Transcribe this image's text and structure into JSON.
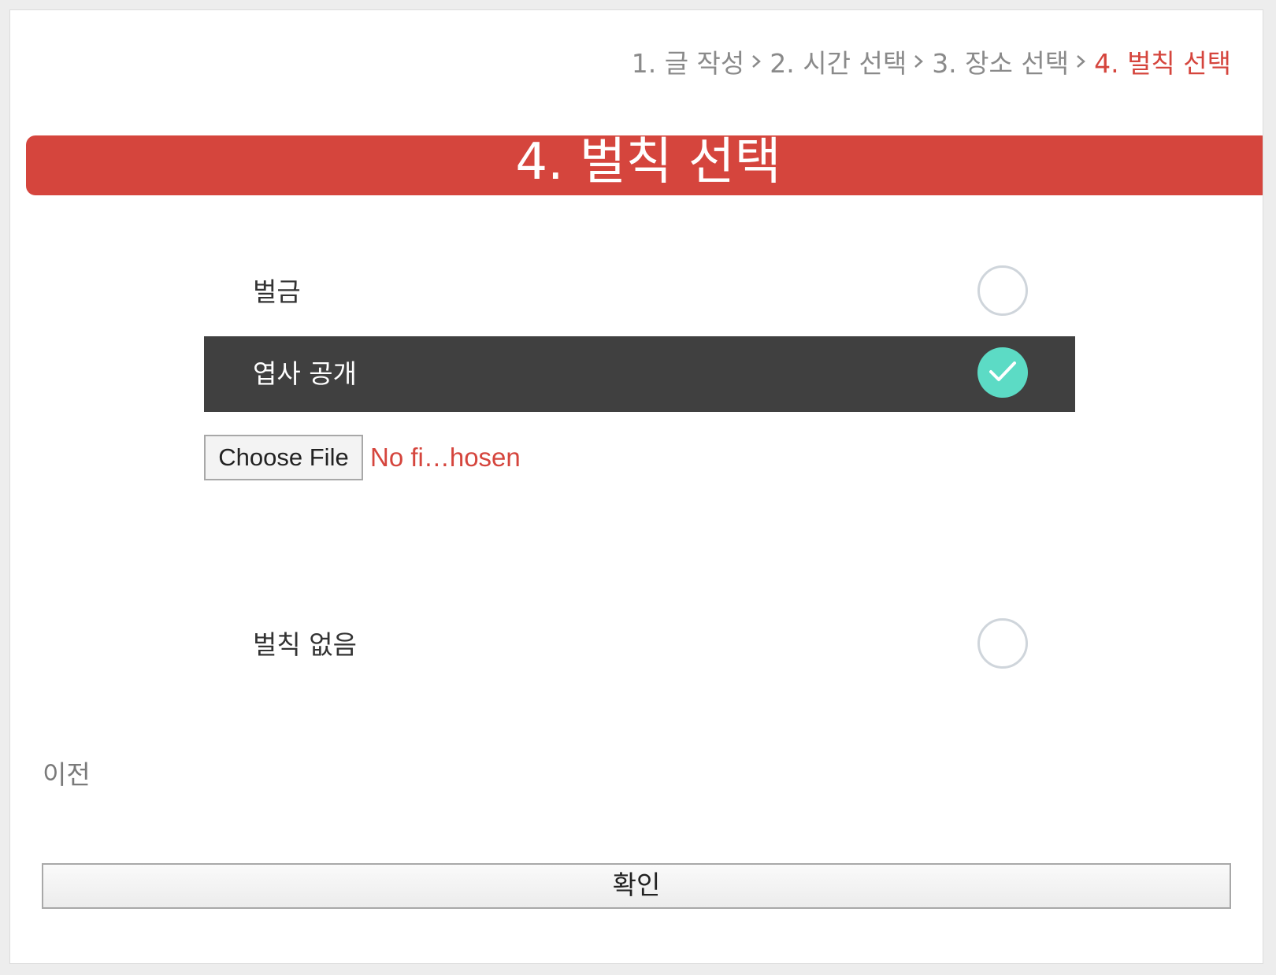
{
  "breadcrumb": {
    "steps": [
      "1. 글 작성",
      "2. 시간 선택",
      "3. 장소 선택",
      "4. 벌칙 선택"
    ],
    "active_index": 3
  },
  "banner": {
    "title": "4. 벌칙 선택"
  },
  "options": [
    {
      "label": "벌금",
      "selected": false
    },
    {
      "label": "엽사 공개",
      "selected": true
    },
    {
      "label": "벌칙 없음",
      "selected": false
    }
  ],
  "file_input": {
    "button_label": "Choose File",
    "status": "No fi…hosen"
  },
  "prev_link": "이전",
  "confirm_button": "확인",
  "colors": {
    "accent": "#d5453d",
    "selected_bg": "#404040",
    "check": "#5cdbc5"
  }
}
